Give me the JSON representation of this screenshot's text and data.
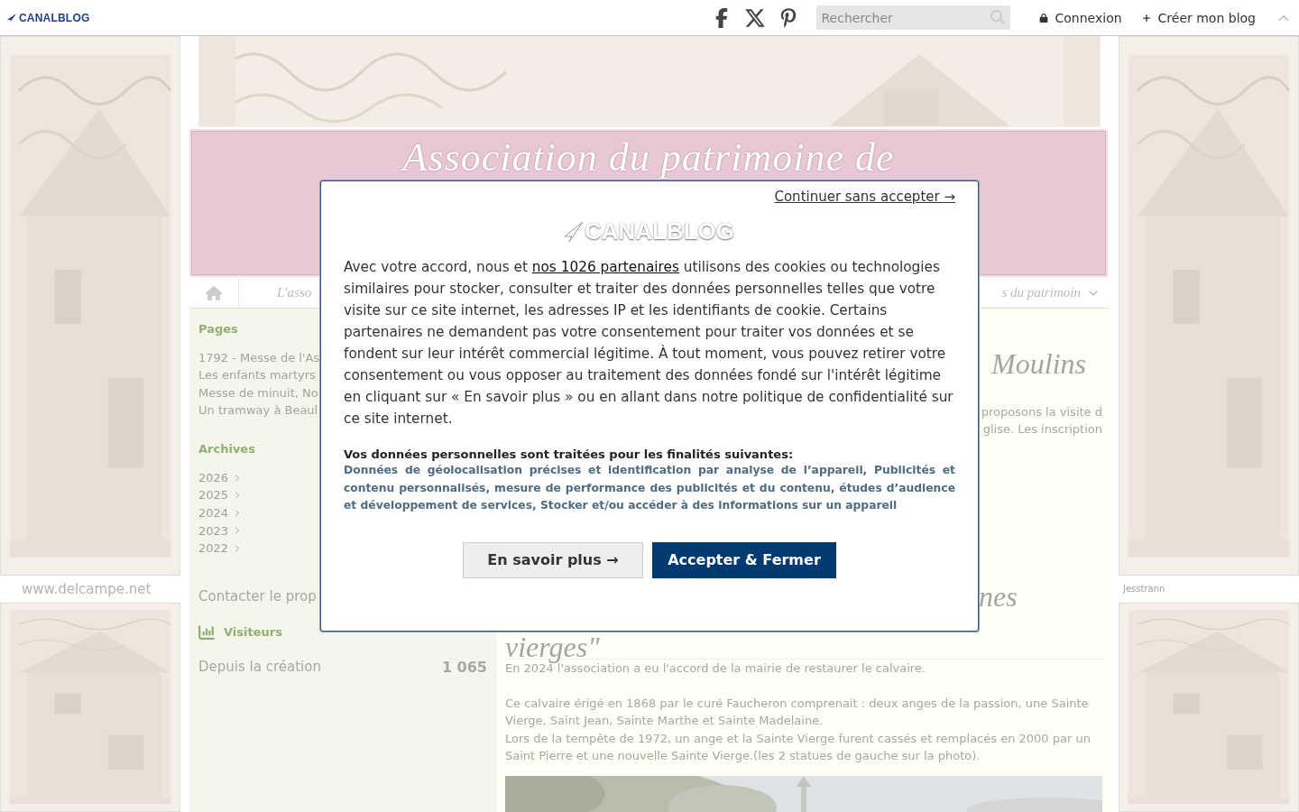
{
  "top_bar": {
    "logo": "CANALBLOG",
    "search": {
      "placeholder": "Rechercher"
    },
    "login": "Connexion",
    "create": "Créer mon blog"
  },
  "background": {
    "left_caption": "www.delcampe.net",
    "right_caption": "Jesstrann"
  },
  "banner": {
    "title": "Association du patrimoine de"
  },
  "nav": {
    "left_item": "L'asso",
    "right_item": "s du patrimoin"
  },
  "sidebar": {
    "pages_title": "Pages",
    "pages": [
      "1792 - Messe de l'As",
      "Les enfants martyrs",
      "Messe de minuit, No",
      "Un tramway à Beaul"
    ],
    "archives_title": "Archives",
    "years": [
      "2026",
      "2025",
      "2024",
      "2023",
      "2022"
    ],
    "contact": "Contacter le prop",
    "visitors_title": "Visiteurs",
    "visitors_label": "Depuis la création",
    "visitors_count": "1 065"
  },
  "posts": [
    {
      "title": "Moulins",
      "lines": [
        "proposons la visite d",
        "glise. Les inscription"
      ]
    },
    {
      "title_end": "nes",
      "title_wrap": "vierges\"",
      "paragraphs": [
        "En 2024 l'association a eu l'accord de la mairie de restaurer le calvaire.",
        "Ce calvaire érigé en 1868 par le curé Faucheron comprenait : deux anges de la passion, une Sainte Vierge, Saint Jean, Sainte Marthe et Sainte Madelaine.\nLors de la tempête de 1972, un ange et la Sainte Vierge furent cassés et remplacés en 2000 par un Saint Pierre et une nouvelle Sainte Vierge.(les 2 statues de gauche sur la photo)."
      ]
    }
  ],
  "consent_dialog": {
    "skip_link": "Continuer sans accepter →",
    "logo": "CANALBLOG",
    "intro_before": "Avec votre accord, nous et ",
    "partners_link": "nos 1026 partenaires",
    "intro_after": " utilisons des cookies ou technologies similaires pour stocker, consulter et traiter des données personnelles telles que votre visite sur ce site internet, les adresses IP et les identifiants de cookie. Certains partenaires ne demandent pas votre consentement pour traiter vos données et se fondent sur leur intérêt commercial légitime. À tout moment, vous pouvez retirer votre consentement ou vous opposer au traitement des données fondé sur l'intérêt légitime en cliquant sur « En savoir plus » ou en allant dans notre politique de confidentialité sur ce site internet.",
    "purposes_title": "Vos données personnelles sont traitées pour les finalités suivantes:",
    "purposes": "Données de géolocalisation précises et identification par analyse de l’appareil, Publicités et contenu personnalisés, mesure de performance des publicités et du contenu, études d’audience et développement de services, Stocker et/ou accéder à des informations sur un appareil",
    "buttons": [
      {
        "label": "En savoir plus →",
        "kind": "secondary"
      },
      {
        "label": "Accepter & Fermer",
        "kind": "primary"
      }
    ]
  }
}
